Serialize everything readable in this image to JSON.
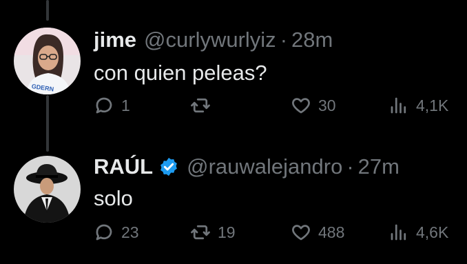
{
  "tweets": [
    {
      "name": "jime",
      "handle": "@curlywurlyiz",
      "separator": "·",
      "time": "28m",
      "text": "con quien peleas?",
      "reply_count": "1",
      "retweet_count": "",
      "like_count": "30",
      "view_count": "4,1K",
      "avatar_hoodie_text": "GDERN"
    },
    {
      "name": "RAÚL",
      "handle": "@rauwalejandro",
      "separator": "·",
      "time": "27m",
      "text": "solo",
      "reply_count": "23",
      "retweet_count": "19",
      "like_count": "488",
      "view_count": "4,6K",
      "verified": true
    }
  ],
  "colors": {
    "background": "#000000",
    "text_primary": "#e7e9ea",
    "text_secondary": "#71767b",
    "verified_blue": "#1d9bf0",
    "thread_line": "#333639"
  },
  "icons": [
    "reply-icon",
    "retweet-icon",
    "like-icon",
    "views-icon",
    "verified-badge-icon"
  ]
}
